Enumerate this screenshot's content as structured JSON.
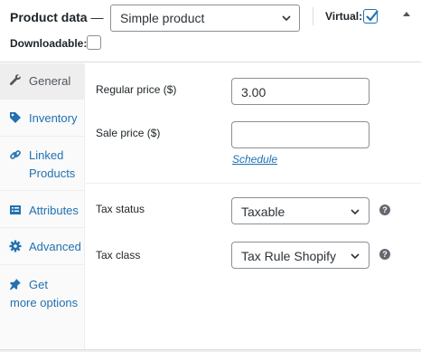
{
  "header": {
    "title": "Product data",
    "separator": "—",
    "product_type": {
      "selected": "Simple product"
    },
    "virtual_label": "Virtual:",
    "virtual_checked": true,
    "downloadable_label": "Downloadable:",
    "downloadable_checked": false,
    "toggle_icon": "caret-up-icon"
  },
  "sidebar": {
    "tabs": [
      {
        "label": "General",
        "icon": "wrench-icon",
        "active": true
      },
      {
        "label": "Inventory",
        "icon": "tag-icon",
        "active": false
      },
      {
        "label": "Linked Products",
        "icon": "link-icon",
        "active": false
      },
      {
        "label": "Attributes",
        "icon": "list-icon",
        "active": false
      },
      {
        "label": "Advanced",
        "icon": "gear-icon",
        "active": false
      },
      {
        "label": "Get",
        "label_rest": "more options",
        "icon": "pin-icon",
        "active": false
      }
    ]
  },
  "general": {
    "regular_price_label": "Regular price ($)",
    "regular_price_value": "3.00",
    "sale_price_label": "Sale price ($)",
    "sale_price_value": "",
    "schedule_link": "Schedule",
    "tax_status_label": "Tax status",
    "tax_status_value": "Taxable",
    "tax_class_label": "Tax class",
    "tax_class_value": "Tax Rule Shopify"
  },
  "colors": {
    "link": "#2271b1",
    "active_tab_bg": "#eeeeee",
    "border": "#8c8f94"
  }
}
